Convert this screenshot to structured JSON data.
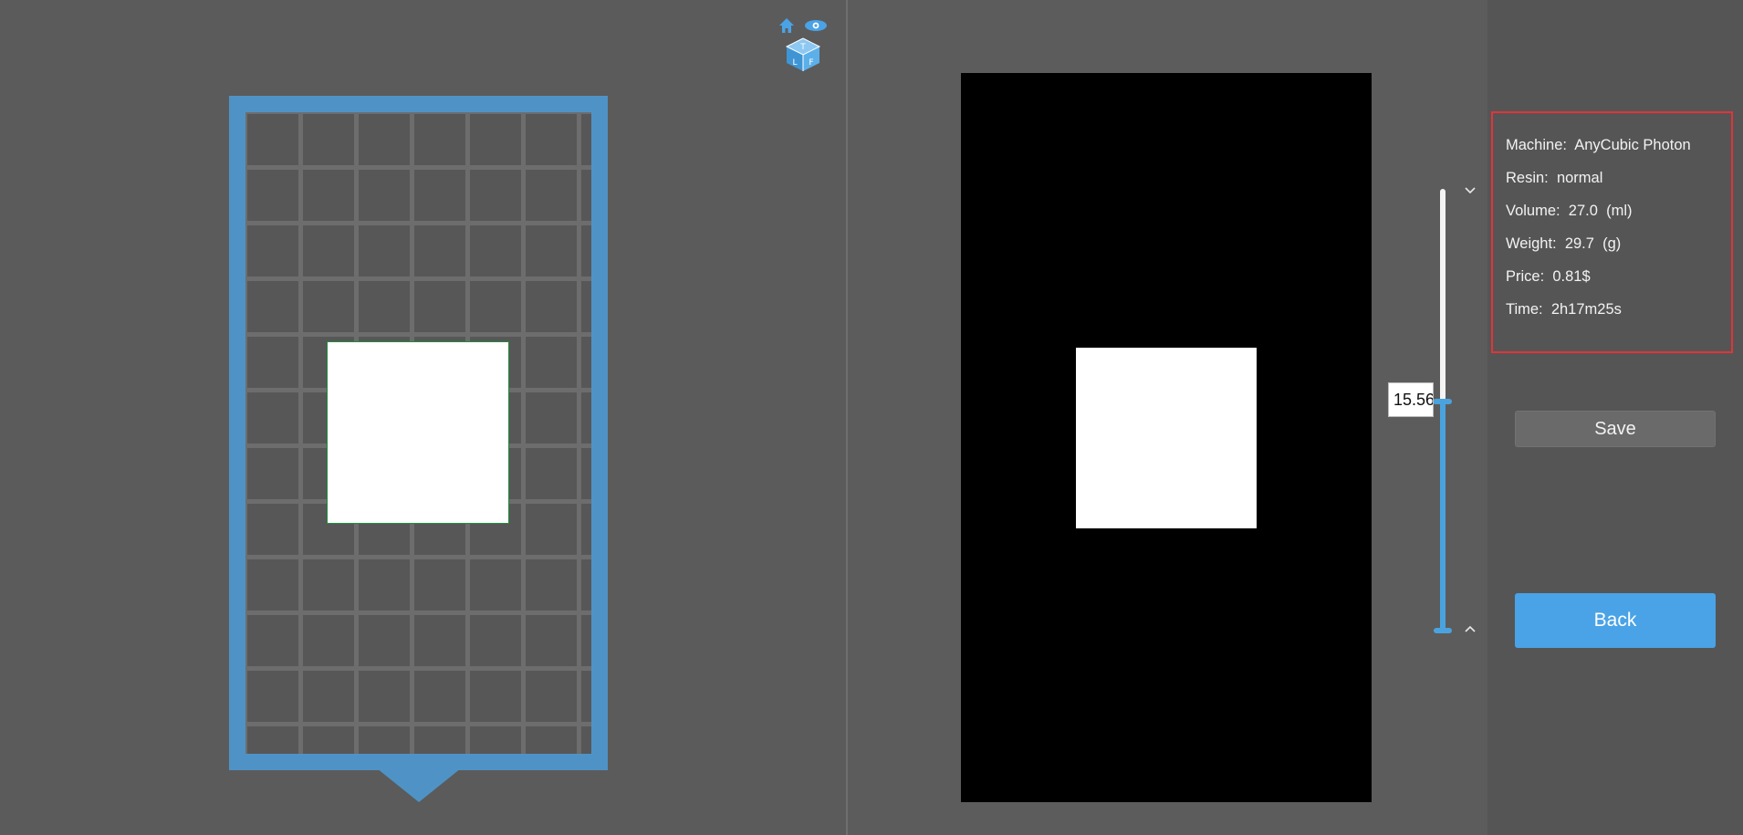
{
  "layer_slider": {
    "value": "15.56",
    "up_icon": "chevron-down-icon",
    "down_icon": "chevron-up-icon"
  },
  "view_cube": {
    "home_icon": "home-icon",
    "eye_icon": "eye-icon",
    "faces": [
      "T",
      "L",
      "F"
    ]
  },
  "info": {
    "machine_label": "Machine:",
    "machine_value": "AnyCubic Photon",
    "resin_label": "Resin:",
    "resin_value": "normal",
    "volume_label": "Volume:",
    "volume_value": "27.0  (ml)",
    "weight_label": "Weight:",
    "weight_value": "29.7  (g)",
    "price_label": "Price:",
    "price_value": "0.81$",
    "time_label": "Time:",
    "time_value": "2h17m25s"
  },
  "buttons": {
    "save_label": "Save",
    "back_label": "Back"
  },
  "colors": {
    "accent": "#4aa3e6",
    "plate": "#4f93c6",
    "highlight_border": "#e0353a"
  }
}
